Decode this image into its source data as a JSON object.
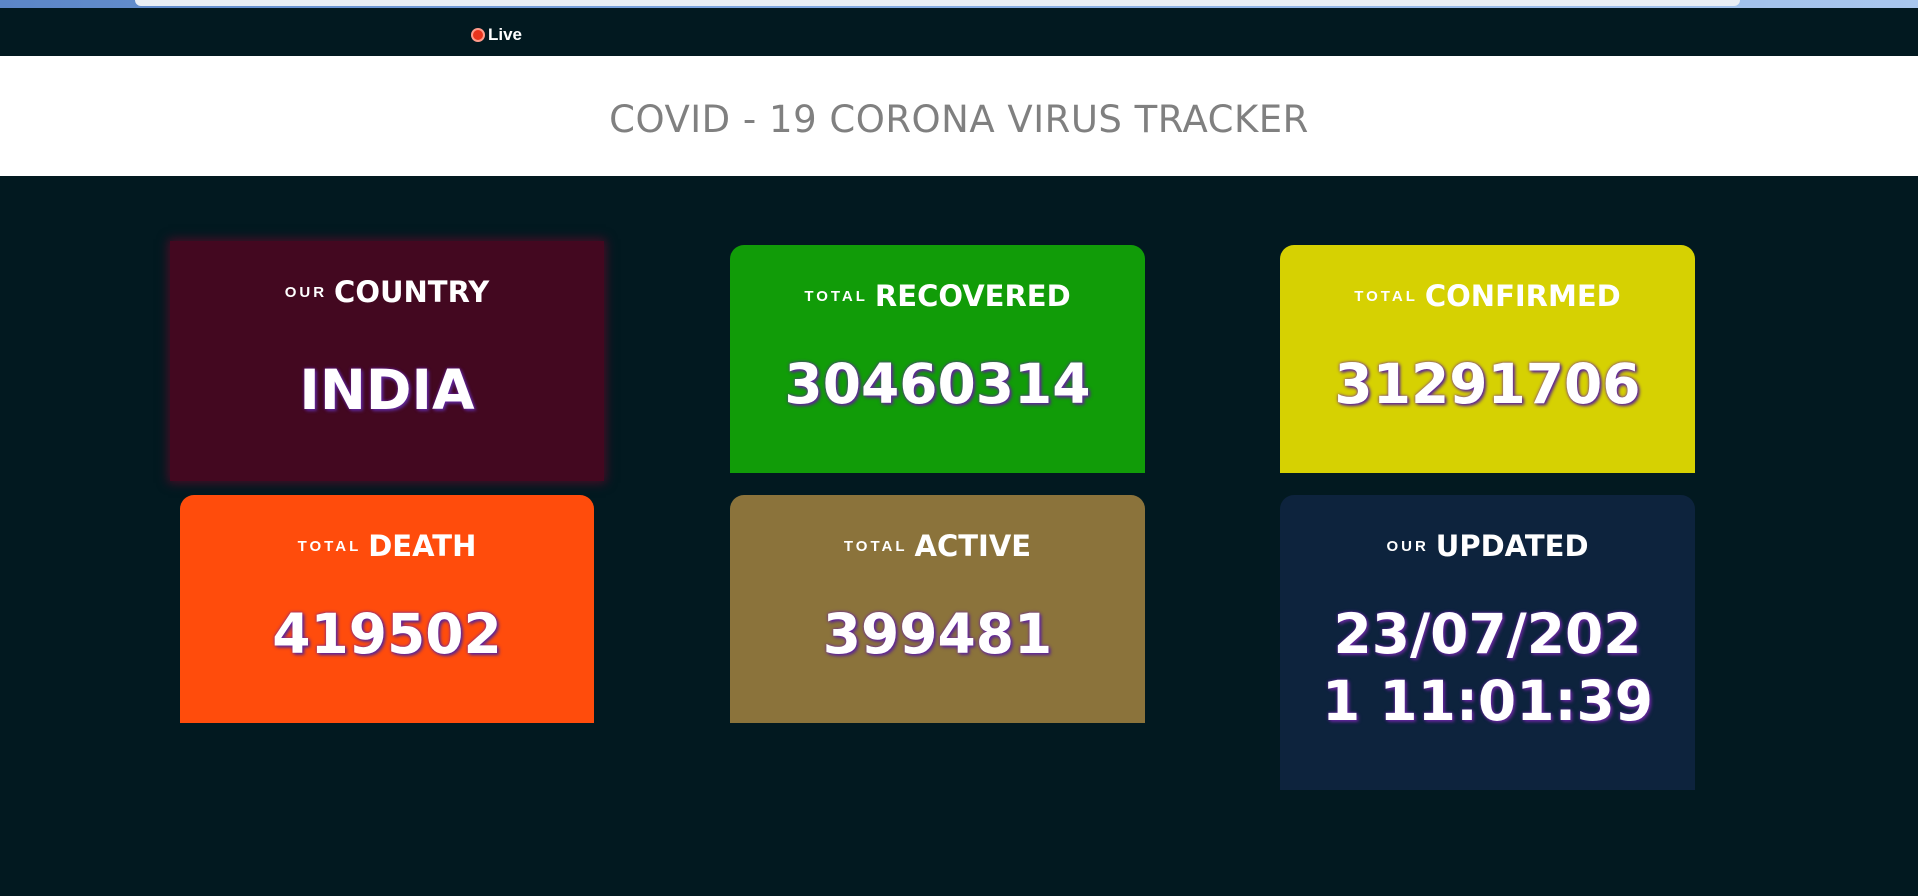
{
  "topbar": {
    "live_label": "Live"
  },
  "header": {
    "title": "COVID - 19 CORONA VIRUS TRACKER"
  },
  "cards": {
    "country": {
      "small": "OUR",
      "big": "COUNTRY",
      "value": "INDIA",
      "color": "#430820"
    },
    "recovered": {
      "small": "TOTAL",
      "big": "RECOVERED",
      "value": "30460314",
      "color": "#119c08"
    },
    "confirmed": {
      "small": "TOTAL",
      "big": "CONFIRMED",
      "value": "31291706",
      "color": "#d6d102"
    },
    "death": {
      "small": "TOTAL",
      "big": "DEATH",
      "value": "419502",
      "color": "#ff4c0c"
    },
    "active": {
      "small": "TOTAL",
      "big": "ACTIVE",
      "value": "399481",
      "color": "#8b733b"
    },
    "updated": {
      "small": "OUR",
      "big": "UPDATED",
      "value_line1": "23/07/202",
      "value_line2": "1 11:01:39",
      "color": "#0d233d"
    }
  }
}
